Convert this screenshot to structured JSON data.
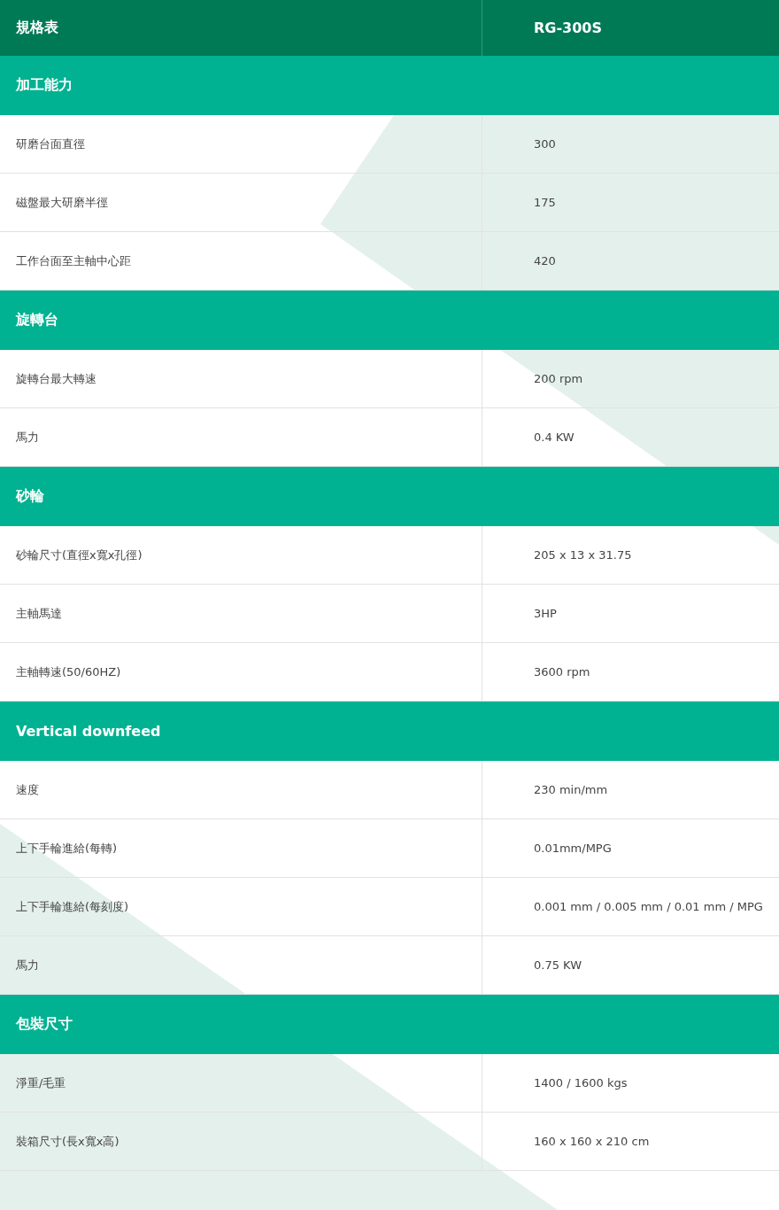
{
  "header": {
    "label": "規格表",
    "model": "RG-300S"
  },
  "sections": [
    {
      "title": "加工能力",
      "rows": [
        {
          "label": "研磨台面直徑",
          "value": "300"
        },
        {
          "label": "磁盤最大研磨半徑",
          "value": "175"
        },
        {
          "label": "工作台面至主軸中心距",
          "value": "420"
        }
      ]
    },
    {
      "title": "旋轉台",
      "rows": [
        {
          "label": "旋轉台最大轉速",
          "value": "200 rpm"
        },
        {
          "label": "馬力",
          "value": "0.4 KW"
        }
      ]
    },
    {
      "title": "砂輪",
      "rows": [
        {
          "label": "砂輪尺寸(直徑x寬x孔徑)",
          "value": "205 x 13 x 31.75"
        },
        {
          "label": "主軸馬達",
          "value": "3HP"
        },
        {
          "label": "主軸轉速(50/60HZ)",
          "value": "3600 rpm"
        }
      ]
    },
    {
      "title": "Vertical downfeed",
      "rows": [
        {
          "label": "速度",
          "value": "230 min/mm"
        },
        {
          "label": "上下手輪進給(每轉)",
          "value": "0.01mm/MPG"
        },
        {
          "label": "上下手輪進給(每刻度)",
          "value": "0.001 mm / 0.005 mm / 0.01 mm / MPG"
        },
        {
          "label": "馬力",
          "value": "0.75 KW"
        }
      ]
    },
    {
      "title": "包裝尺寸",
      "rows": [
        {
          "label": "淨重/毛重",
          "value": "1400 / 1600 kgs"
        },
        {
          "label": "裝箱尺寸(長x寬x高)",
          "value": "160 x 160 x 210 cm"
        }
      ]
    }
  ]
}
